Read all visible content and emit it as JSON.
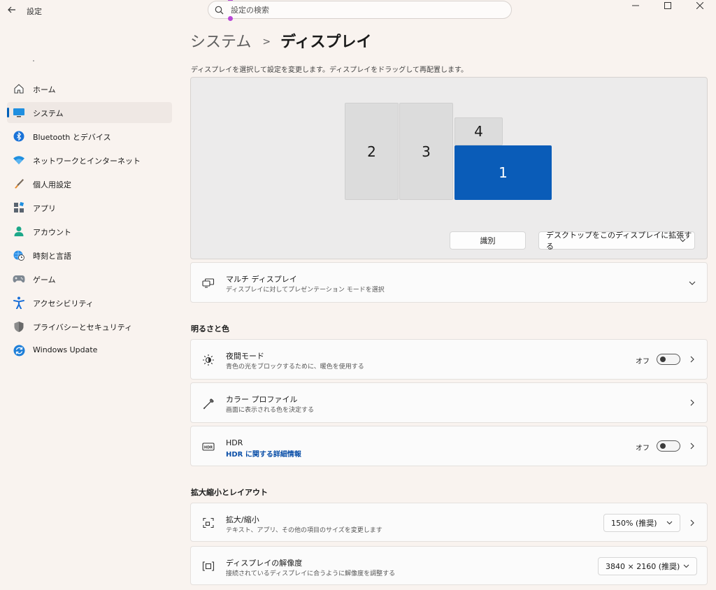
{
  "app": {
    "title": "設定"
  },
  "search": {
    "placeholder": "設定の検索"
  },
  "sidebar": {
    "items": [
      {
        "label": "ホーム",
        "icon": "home-icon"
      },
      {
        "label": "システム",
        "icon": "monitor-icon"
      },
      {
        "label": "Bluetooth とデバイス",
        "icon": "bluetooth-icon"
      },
      {
        "label": "ネットワークとインターネット",
        "icon": "wifi-icon"
      },
      {
        "label": "個人用設定",
        "icon": "brush-icon"
      },
      {
        "label": "アプリ",
        "icon": "apps-icon"
      },
      {
        "label": "アカウント",
        "icon": "account-icon"
      },
      {
        "label": "時刻と言語",
        "icon": "globe-clock-icon"
      },
      {
        "label": "ゲーム",
        "icon": "gamepad-icon"
      },
      {
        "label": "アクセシビリティ",
        "icon": "accessibility-icon"
      },
      {
        "label": "プライバシーとセキュリティ",
        "icon": "shield-icon"
      },
      {
        "label": "Windows Update",
        "icon": "update-icon"
      }
    ]
  },
  "breadcrumb": {
    "parent": "システム",
    "current": "ディスプレイ"
  },
  "arrange": {
    "description": "ディスプレイを選択して設定を変更します。ディスプレイをドラッグして再配置します。",
    "monitors": [
      "2",
      "3",
      "4",
      "1"
    ],
    "identify_label": "識別",
    "extend_label": "デスクトップをこのディスプレイに拡張する"
  },
  "multi_display": {
    "title": "マルチ ディスプレイ",
    "subtitle": "ディスプレイに対してプレゼンテーション モードを選択"
  },
  "brightness_section": {
    "heading": "明るさと色"
  },
  "night_light": {
    "title": "夜間モード",
    "subtitle": "青色の光をブロックするために、暖色を使用する",
    "state": "オフ"
  },
  "color_profile": {
    "title": "カラー プロファイル",
    "subtitle": "画面に表示される色を決定する"
  },
  "hdr": {
    "title": "HDR",
    "link": "HDR に関する詳細情報",
    "state": "オフ"
  },
  "scale_section": {
    "heading": "拡大縮小とレイアウト"
  },
  "scale": {
    "title": "拡大/縮小",
    "subtitle": "テキスト、アプリ、その他の項目のサイズを変更します",
    "value": "150% (推奨)"
  },
  "resolution": {
    "title": "ディスプレイの解像度",
    "subtitle": "接続されているディスプレイに合うように解像度を調整する",
    "value": "3840 × 2160 (推奨)"
  },
  "colors": {
    "accent": "#005fb8",
    "primary_monitor": "#0a5cb8",
    "background": "#f9f3ef"
  }
}
